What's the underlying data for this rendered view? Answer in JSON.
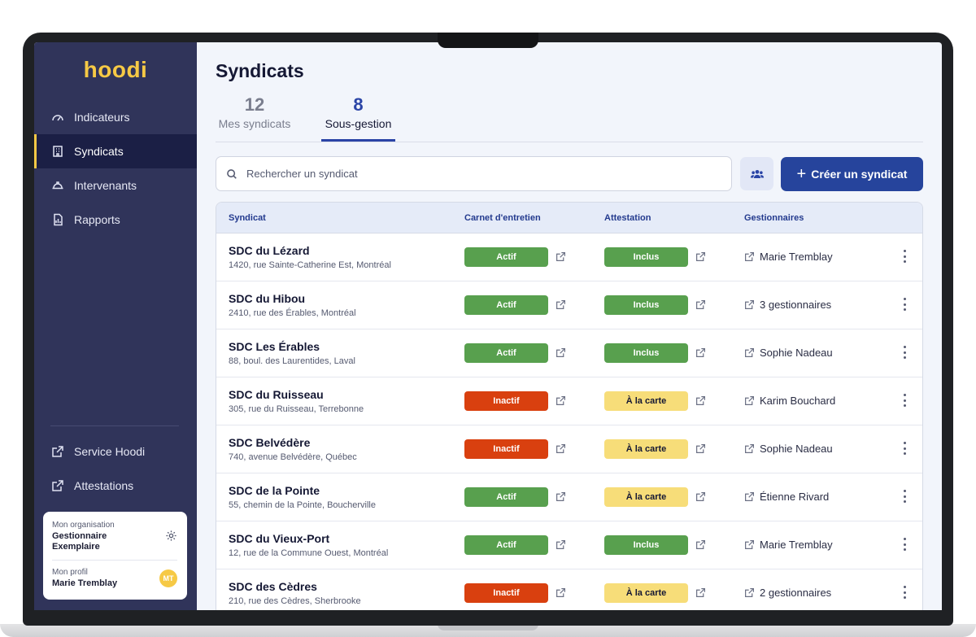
{
  "app": {
    "logo": "hoodi",
    "brand_color": "#f6c945",
    "accent_color": "#26449c"
  },
  "sidebar": {
    "nav": [
      {
        "label": "Indicateurs",
        "icon": "gauge-icon",
        "active": false
      },
      {
        "label": "Syndicats",
        "icon": "building-icon",
        "active": true
      },
      {
        "label": "Intervenants",
        "icon": "hardhat-icon",
        "active": false
      },
      {
        "label": "Rapports",
        "icon": "report-icon",
        "active": false
      }
    ],
    "links": [
      {
        "label": "Service Hoodi",
        "icon": "external-link-icon"
      },
      {
        "label": "Attestations",
        "icon": "external-link-icon"
      }
    ],
    "org": {
      "caption": "Mon organisation",
      "name": "Gestionnaire Exemplaire"
    },
    "profile": {
      "caption": "Mon profil",
      "name": "Marie Tremblay",
      "initials": "MT"
    }
  },
  "main": {
    "title": "Syndicats",
    "tabs": [
      {
        "count": "12",
        "label": "Mes syndicats",
        "active": false
      },
      {
        "count": "8",
        "label": "Sous-gestion",
        "active": true
      }
    ],
    "search": {
      "placeholder": "Rechercher un syndicat",
      "value": ""
    },
    "create_label": "Créer un syndicat",
    "table": {
      "columns": [
        "Syndicat",
        "Carnet d'entretien",
        "Attestation",
        "Gestionnaires"
      ],
      "rows": [
        {
          "name": "SDC du Lézard",
          "address": "1420, rue Sainte-Catherine Est, Montréal",
          "carnet": "Actif",
          "carnet_status": "green",
          "attestation": "Inclus",
          "attestation_status": "green",
          "manager": "Marie Tremblay"
        },
        {
          "name": "SDC du Hibou",
          "address": "2410, rue des Érables, Montréal",
          "carnet": "Actif",
          "carnet_status": "green",
          "attestation": "Inclus",
          "attestation_status": "green",
          "manager": "3 gestionnaires"
        },
        {
          "name": "SDC Les Érables",
          "address": "88, boul. des Laurentides, Laval",
          "carnet": "Actif",
          "carnet_status": "green",
          "attestation": "Inclus",
          "attestation_status": "green",
          "manager": "Sophie Nadeau"
        },
        {
          "name": "SDC du Ruisseau",
          "address": "305, rue du Ruisseau, Terrebonne",
          "carnet": "Inactif",
          "carnet_status": "red",
          "attestation": "À la carte",
          "attestation_status": "yellow",
          "manager": "Karim Bouchard"
        },
        {
          "name": "SDC Belvédère",
          "address": "740, avenue Belvédère, Québec",
          "carnet": "Inactif",
          "carnet_status": "red",
          "attestation": "À la carte",
          "attestation_status": "yellow",
          "manager": "Sophie Nadeau"
        },
        {
          "name": "SDC de la Pointe",
          "address": "55, chemin de la Pointe, Boucherville",
          "carnet": "Actif",
          "carnet_status": "green",
          "attestation": "À la carte",
          "attestation_status": "yellow",
          "manager": "Étienne Rivard"
        },
        {
          "name": "SDC du Vieux-Port",
          "address": "12, rue de la Commune Ouest, Montréal",
          "carnet": "Actif",
          "carnet_status": "green",
          "attestation": "Inclus",
          "attestation_status": "green",
          "manager": "Marie Tremblay"
        },
        {
          "name": "SDC des Cèdres",
          "address": "210, rue des Cèdres, Sherbrooke",
          "carnet": "Inactif",
          "carnet_status": "red",
          "attestation": "À la carte",
          "attestation_status": "yellow",
          "manager": "2 gestionnaires"
        }
      ]
    }
  }
}
